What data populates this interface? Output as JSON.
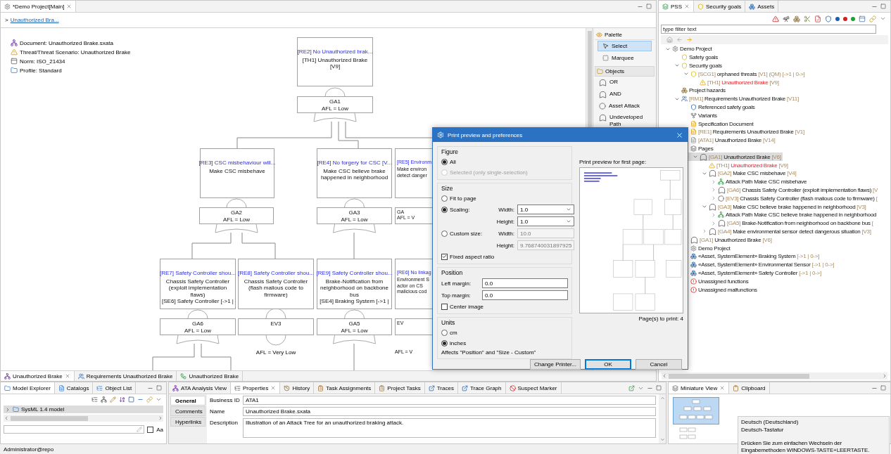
{
  "editor": {
    "tab": {
      "title": "*Demo Project[Main]"
    },
    "breadcrumb": {
      "separator": ">",
      "link": "Unauthorized Bra..."
    },
    "info": [
      {
        "kind": "document",
        "text": "Document: Unauthorized Brake.sxata"
      },
      {
        "kind": "threat",
        "text": "Threat/Threat Scenario: Unauthorized Brake"
      },
      {
        "kind": "norm",
        "text": "Norm: ISO_21434"
      },
      {
        "kind": "profile",
        "text": "Profile: Standard"
      }
    ],
    "nodes": [
      {
        "kind": "requirement",
        "title": "[RE2] No Unauthorized brak...",
        "lines": [
          "[TH1] Unauthorized Brake",
          "[V9]"
        ]
      },
      {
        "kind": "gate",
        "lines": [
          "GA1",
          "AFL = Low"
        ]
      },
      {
        "kind": "requirement",
        "title": "[RE3] CSC misbehaviour will...",
        "lines": [
          "Make CSC misbehave"
        ]
      },
      {
        "kind": "requirement",
        "title": "[RE4] No forgery for CSC [V...",
        "lines": [
          "Make CSC believe brake",
          "happened in neighborhood"
        ]
      },
      {
        "kind": "requirement",
        "title": "[RE5] Environm",
        "lines": [
          "Make environ",
          "detect danger"
        ]
      },
      {
        "kind": "gate",
        "lines": [
          "GA2",
          "AFL = Low"
        ]
      },
      {
        "kind": "gate",
        "lines": [
          "GA3",
          "AFL = Low"
        ]
      },
      {
        "kind": "gate",
        "lines": [
          "GA",
          "AFL = V"
        ]
      },
      {
        "kind": "requirement",
        "title": "[RE7] Safety Controller shou...",
        "lines": [
          "Chassis Safety Controller",
          "(exploit implementation",
          "flaws)",
          "[SE6] Safety Controller [->1 |"
        ]
      },
      {
        "kind": "requirement",
        "title": "[RE8] Safety Controller shou...",
        "lines": [
          "Chassis Safety Controller",
          "(flash malious code to",
          "firmware)"
        ]
      },
      {
        "kind": "requirement",
        "title": "[RE9] Safety Controller shou...",
        "lines": [
          "Brake-Notification from",
          "neighborhood on backbone",
          "bus",
          "[SE4] Braking System [->1 |"
        ]
      },
      {
        "kind": "requirement",
        "title": "[RE6] No linkag",
        "lines": [
          "Environment S",
          "actor on CS",
          "malicious cod"
        ]
      },
      {
        "kind": "gate",
        "lines": [
          "GA6",
          "AFL = Low"
        ]
      },
      {
        "kind": "event",
        "lines": [
          "EV3"
        ],
        "below": "AFL = Very Low"
      },
      {
        "kind": "gate",
        "lines": [
          "GA5",
          "AFL = Low"
        ]
      },
      {
        "kind": "event",
        "lines": [
          "EV"
        ],
        "below": "AFL = V"
      }
    ],
    "palette": {
      "title": "Palette",
      "tools": [
        {
          "kind": "select",
          "label": "Select",
          "selected": true
        },
        {
          "kind": "marquee",
          "label": "Marquee",
          "selected": false
        }
      ],
      "section": "Objects",
      "objects": [
        {
          "kind": "gate",
          "label": "OR"
        },
        {
          "kind": "gate",
          "label": "AND"
        },
        {
          "kind": "event",
          "label": "Asset Attack"
        },
        {
          "kind": "gate",
          "label": "Undeveloped Path"
        }
      ]
    },
    "diagram_tabs": [
      {
        "kind": "tree",
        "label": "Unauthorized Brake",
        "selected": true
      },
      {
        "kind": "requirements",
        "label": "Requirements Unauthorized Brake",
        "selected": false
      },
      {
        "kind": "graph",
        "label": "Unauthorized Brake",
        "selected": false
      }
    ]
  },
  "pss": {
    "tabs": [
      {
        "kind": "pss",
        "label": "PSS",
        "selected": true
      },
      {
        "kind": "goals",
        "label": "Security goals",
        "selected": false
      },
      {
        "kind": "assets",
        "label": "Assets",
        "selected": false
      }
    ],
    "filter": {
      "placeholder": "type filter text"
    },
    "tree": [
      {
        "kind": "project",
        "label": "Demo Project",
        "expanded": true,
        "selected": false,
        "children": [
          {
            "kind": "goal",
            "label": "Safety goals",
            "selected": false
          },
          {
            "kind": "goal",
            "label": "Security goals",
            "expanded": true,
            "selected": false,
            "children": [
              {
                "kind": "goal",
                "id": "[SCG1]",
                "label": "orphaned threats",
                "suffix": "[V1] (QM) [->1 | 0->]",
                "expanded": true,
                "selected": false,
                "children": [
                  {
                    "kind": "threat",
                    "id": "[TH1]",
                    "label": "Unauthorized Brake",
                    "suffix": "[V9]",
                    "selected": false
                  }
                ]
              }
            ]
          },
          {
            "kind": "hazard",
            "label": "Project hazards",
            "selected": false
          },
          {
            "kind": "requirements",
            "id": "[RM1]",
            "label": "Requirements Unauthorized Brake",
            "suffix": "[V11]",
            "expanded": true,
            "selected": false,
            "children": [
              {
                "kind": "shield",
                "label": "Referenced safety goals",
                "selected": false
              },
              {
                "kind": "variant",
                "label": "Variants",
                "selected": false
              },
              {
                "kind": "spec",
                "label": "Specification Document",
                "selected": false
              },
              {
                "kind": "spec",
                "id": "[RE1]",
                "label": "Requirements Unauthorized Brake",
                "suffix": "[V1]",
                "selected": false
              },
              {
                "kind": "analysis",
                "id": "[ATA1]",
                "label": "Unauthorized Brake",
                "suffix": "[V14]",
                "selected": false
              },
              {
                "kind": "pages",
                "label": "Pages",
                "selected": false,
                "children": [
                  {
                    "kind": "gate",
                    "id": "[GA1]",
                    "label": "Unauthorized Brake",
                    "suffix": "[V6]",
                    "expanded": true,
                    "selected": true,
                    "children": [
                      {
                        "kind": "threat",
                        "id": "[TH1]",
                        "label": "Unauthorized Brake",
                        "suffix": "[V9]",
                        "selected": false
                      },
                      {
                        "kind": "gate",
                        "id": "[GA2]",
                        "label": "Make CSC misbehave",
                        "suffix": "[V4]",
                        "expanded": true,
                        "selected": false,
                        "children": [
                          {
                            "kind": "path",
                            "label": "Attack Path Make CSC misbehave",
                            "expanded": false,
                            "selected": false
                          },
                          {
                            "kind": "gate",
                            "id": "[GA6]",
                            "label": "Chassis Safety Controller (exploit implementation flaws)",
                            "suffix": "[V",
                            "expanded": false,
                            "selected": false
                          },
                          {
                            "kind": "event",
                            "id": "[EV3]",
                            "label": "Chassis Safety Controller (flash malious code to firmware)",
                            "suffix": "[",
                            "expanded": false,
                            "selected": false
                          }
                        ]
                      },
                      {
                        "kind": "gate",
                        "id": "[GA3]",
                        "label": "Make CSC believe brake happened in neighborhood",
                        "suffix": "[V3]",
                        "expanded": true,
                        "selected": false,
                        "children": [
                          {
                            "kind": "path",
                            "label": "Attack Path Make CSC believe brake happened in neighborhood",
                            "expanded": false,
                            "selected": false
                          },
                          {
                            "kind": "gate",
                            "id": "[GA5]",
                            "label": "Brake-Notification from neighborhood on backbone bus",
                            "suffix": "[",
                            "expanded": false,
                            "selected": false
                          }
                        ]
                      },
                      {
                        "kind": "gate",
                        "id": "[GA4]",
                        "label": "Make environmental sensor detect dangerous situation",
                        "suffix": "[V3]",
                        "expanded": false,
                        "selected": false
                      }
                    ]
                  }
                ]
              },
              {
                "kind": "gate",
                "id": "[GA1]",
                "label": "Unauthorized Brake",
                "suffix": "[V6]",
                "selected": false
              },
              {
                "kind": "project",
                "label": "Demo Project",
                "selected": false
              },
              {
                "kind": "asset",
                "label": "«Asset, SystemElement» Braking System",
                "suffix": "[->1 | 0->]",
                "selected": false
              },
              {
                "kind": "asset",
                "label": "«Asset, SystemElement» Environmental Sensor",
                "suffix": "[->1 | 0->]",
                "selected": false
              },
              {
                "kind": "asset",
                "label": "«Asset, SystemElement» Safety Controller",
                "suffix": "[->1 | 0->]",
                "selected": false
              },
              {
                "kind": "unassigned",
                "label": "Unassigned functions",
                "selected": false
              },
              {
                "kind": "unassigned",
                "label": "Unassigned malfunctions",
                "selected": false
              }
            ]
          }
        ]
      }
    ]
  },
  "model_explorer": {
    "tabs": [
      {
        "label": "Model Explorer",
        "selected": true
      },
      {
        "label": "Catalogs",
        "selected": false
      },
      {
        "label": "Object List",
        "selected": false
      }
    ],
    "tree": [
      {
        "label": "SysML 1.4 model",
        "expanded": false,
        "selected": true
      }
    ],
    "match_case": {
      "label": "Aa",
      "checked": false
    }
  },
  "properties": {
    "tabs": [
      {
        "kind": "analysis",
        "label": "ATA Analysis View",
        "selected": false
      },
      {
        "kind": "properties",
        "label": "Properties",
        "selected": true
      },
      {
        "kind": "history",
        "label": "History",
        "selected": false
      },
      {
        "kind": "tasks",
        "label": "Task Assignments",
        "selected": false
      },
      {
        "kind": "tasks",
        "label": "Project Tasks",
        "selected": false
      },
      {
        "kind": "link",
        "label": "Traces",
        "selected": false
      },
      {
        "kind": "link",
        "label": "Trace Graph",
        "selected": false
      },
      {
        "kind": "suspect",
        "label": "Suspect Marker",
        "selected": false
      }
    ],
    "side_tabs": [
      {
        "label": "General",
        "selected": true
      },
      {
        "label": "Comments",
        "selected": false
      },
      {
        "label": "Hyperlinks",
        "selected": false
      }
    ],
    "fields": [
      {
        "kind": "line",
        "label": "Business ID",
        "value": "ATA1"
      },
      {
        "kind": "line",
        "label": "Name",
        "value": "Unauthorized Brake.sxata"
      },
      {
        "kind": "multiline",
        "label": "Description",
        "value": "Illustration of an Attack Tree for an unauthorized braking attack."
      }
    ]
  },
  "miniature": {
    "tabs": [
      {
        "label": "Miniature View",
        "selected": true
      },
      {
        "label": "Clipboard",
        "selected": false
      }
    ]
  },
  "status_bar": {
    "user": "Administrator@repo"
  },
  "dialog": {
    "title": "Print preview and preferences",
    "figure": {
      "title": "Figure",
      "options": [
        {
          "label": "All",
          "selected": true,
          "disabled": false
        },
        {
          "label": "Selected (only single-selection)",
          "selected": false,
          "disabled": true
        }
      ]
    },
    "size": {
      "title": "Size",
      "options": [
        {
          "label": "Fit to page",
          "selected": false
        },
        {
          "label": "Scaling:",
          "selected": true
        },
        {
          "label": "Custom size:",
          "selected": false
        }
      ],
      "scaling": [
        {
          "label": "Width:",
          "value": "1.0"
        },
        {
          "label": "Height:",
          "value": "1.0"
        }
      ],
      "custom": [
        {
          "label": "Width:",
          "value": "10.0"
        },
        {
          "label": "Height:",
          "value": "9.768740031897925"
        }
      ],
      "aspect": {
        "label": "Fixed aspect ratio",
        "checked": true
      }
    },
    "position": {
      "title": "Position",
      "fields": [
        {
          "label": "Left margin:",
          "value": "0.0"
        },
        {
          "label": "Top margin:",
          "value": "0.0"
        }
      ],
      "center": {
        "label": "Center image",
        "checked": false
      }
    },
    "units": {
      "title": "Units",
      "options": [
        {
          "label": "cm",
          "selected": false
        },
        {
          "label": "inches",
          "selected": true
        }
      ],
      "note": "Affects \"Position\" and \"Size - Custom\""
    },
    "preview": {
      "label": "Print preview for first page:",
      "pages": "Page(s) to print: 4"
    },
    "buttons": [
      {
        "label": "Change Printer...",
        "default": false
      },
      {
        "label": "OK",
        "default": true
      },
      {
        "label": "Cancel",
        "default": false
      }
    ]
  },
  "ime_tooltip": {
    "language": "Deutsch (Deutschland)",
    "layout": "Deutsch-Tastatur",
    "hint": "Drücken Sie zum einfachen Wechseln der Eingabemethoden WINDOWS-TASTE+LEERTASTE."
  }
}
